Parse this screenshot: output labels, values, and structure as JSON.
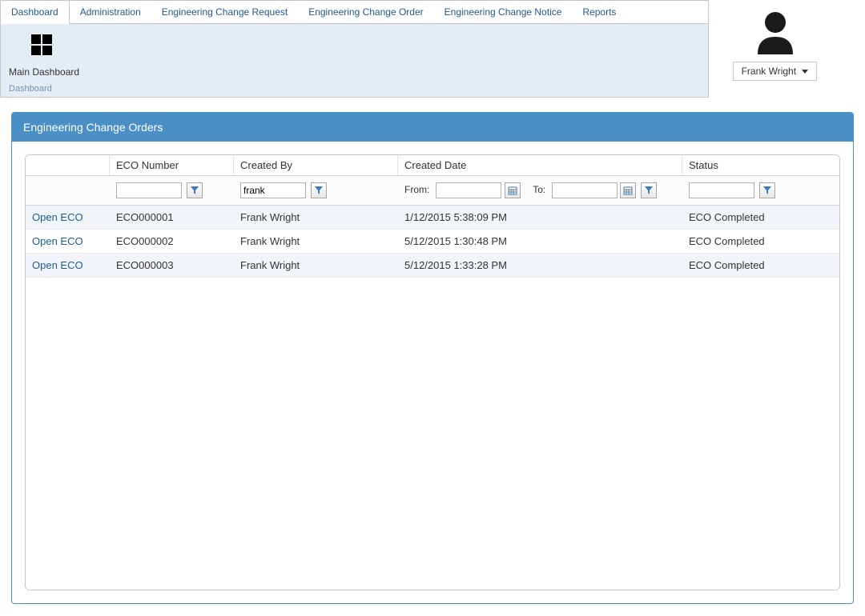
{
  "tabs": {
    "dashboard": "Dashboard",
    "administration": "Administration",
    "ecr": "Engineering Change Request",
    "eco": "Engineering Change Order",
    "ecn": "Engineering Change Notice",
    "reports": "Reports"
  },
  "ribbon": {
    "main_dashboard": "Main Dashboard",
    "group_label": "Dashboard"
  },
  "user": {
    "name": "Frank Wright"
  },
  "panel": {
    "title": "Engineering Change Orders"
  },
  "grid": {
    "headers": {
      "eco_number": "ECO Number",
      "created_by": "Created By",
      "created_date": "Created Date",
      "status": "Status"
    },
    "filters": {
      "eco_number": "",
      "created_by": "frank",
      "from_label": "From:",
      "to_label": "To:",
      "from": "",
      "to": "",
      "status": ""
    },
    "rows": [
      {
        "action": "Open ECO",
        "eco": "ECO000001",
        "created_by": "Frank Wright",
        "date": "1/12/2015 5:38:09 PM",
        "status": "ECO Completed"
      },
      {
        "action": "Open ECO",
        "eco": "ECO000002",
        "created_by": "Frank Wright",
        "date": "5/12/2015 1:30:48 PM",
        "status": "ECO Completed"
      },
      {
        "action": "Open ECO",
        "eco": "ECO000003",
        "created_by": "Frank Wright",
        "date": "5/12/2015 1:33:28 PM",
        "status": "ECO Completed"
      }
    ]
  }
}
